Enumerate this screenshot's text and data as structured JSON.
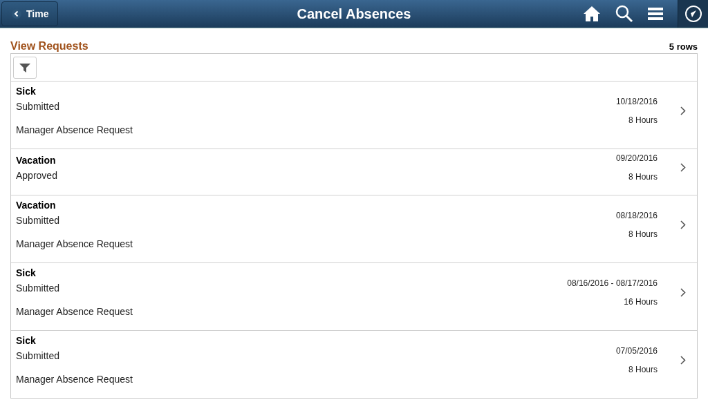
{
  "header": {
    "back_button": "Time",
    "title": "Cancel Absences"
  },
  "section": {
    "title": "View Requests",
    "row_count": "5 rows"
  },
  "requests": [
    {
      "type": "Sick",
      "status": "Submitted",
      "source": "Manager Absence Request",
      "dates": "10/18/2016",
      "duration": "8 Hours"
    },
    {
      "type": "Vacation",
      "status": "Approved",
      "dates": "09/20/2016",
      "duration": "8 Hours"
    },
    {
      "type": "Vacation",
      "status": "Submitted",
      "source": "Manager Absence Request",
      "dates": "08/18/2016",
      "duration": "8 Hours"
    },
    {
      "type": "Sick",
      "status": "Submitted",
      "source": "Manager Absence Request",
      "dates": "08/16/2016 - 08/17/2016",
      "duration": "16 Hours"
    },
    {
      "type": "Sick",
      "status": "Submitted",
      "source": "Manager Absence Request",
      "dates": "07/05/2016",
      "duration": "8 Hours"
    }
  ]
}
